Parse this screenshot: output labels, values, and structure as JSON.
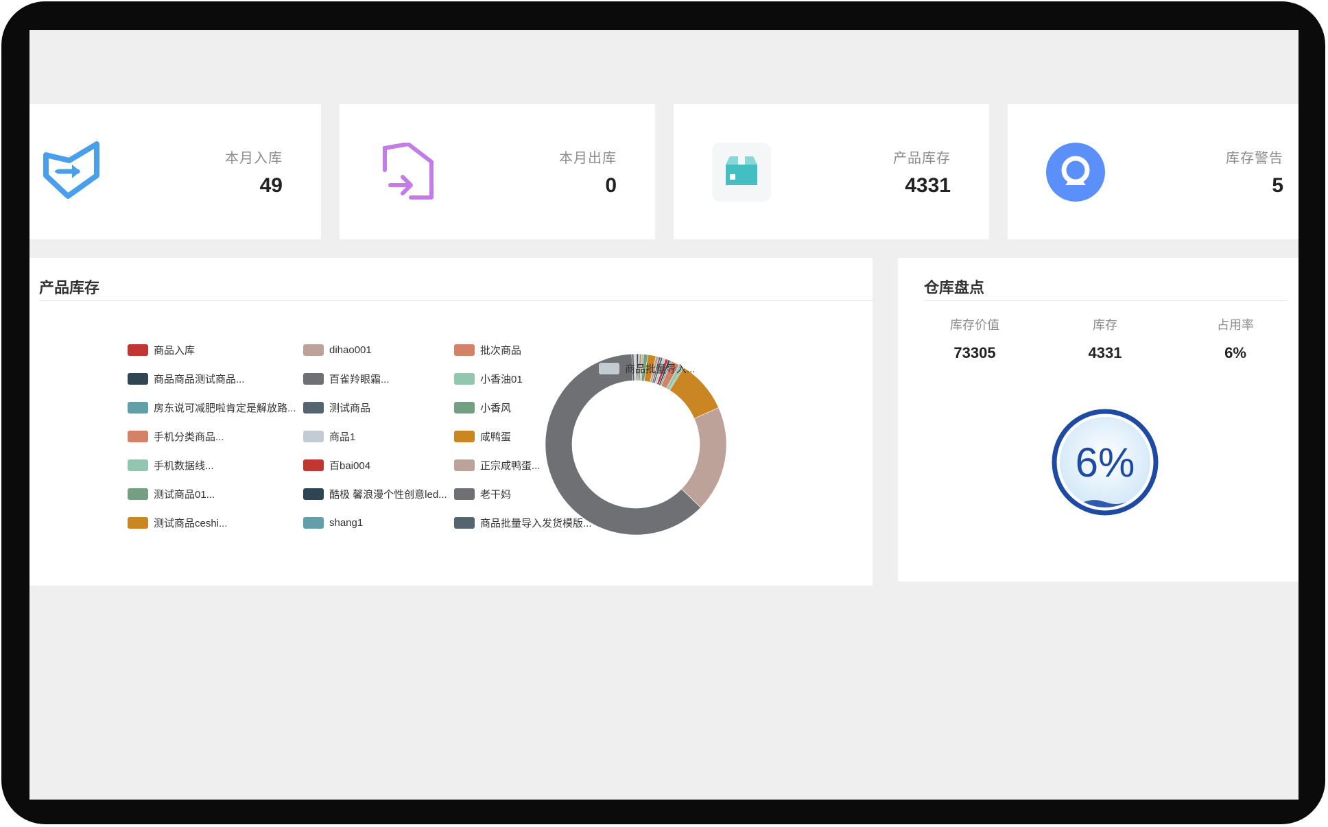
{
  "stats": [
    {
      "label": "本月入库",
      "value": "49",
      "icon": "shield-arrow-in-icon",
      "color": "#4a9fea"
    },
    {
      "label": "本月出库",
      "value": "0",
      "icon": "house-arrow-out-icon",
      "color": "#c27ce8"
    },
    {
      "label": "产品库存",
      "value": "4331",
      "icon": "box-icon",
      "color": "#43bec1"
    },
    {
      "label": "库存警告",
      "value": "5",
      "icon": "webcam-warning-icon",
      "color": "#5b8ff9"
    }
  ],
  "product_stock": {
    "title": "产品库存",
    "legend": [
      {
        "label": "商品入库",
        "color": "#c23531"
      },
      {
        "label": "商品商品测试商品...",
        "color": "#2f4554"
      },
      {
        "label": "房东说可减肥啦肯定是解放路...",
        "color": "#61a0a8"
      },
      {
        "label": "手机分类商品...",
        "color": "#d48265"
      },
      {
        "label": "手机数据线...",
        "color": "#91c7ae"
      },
      {
        "label": "测试商品01...",
        "color": "#749f83"
      },
      {
        "label": "测试商品ceshi...",
        "color": "#ca8622"
      },
      {
        "label": "dihao001",
        "color": "#bda29a"
      },
      {
        "label": "百雀羚眼霜...",
        "color": "#6e7074"
      },
      {
        "label": "测试商品",
        "color": "#546570"
      },
      {
        "label": "商品1",
        "color": "#c4ccd3"
      },
      {
        "label": "百bai004",
        "color": "#c23531"
      },
      {
        "label": "酷极 馨浪漫个性创意led...",
        "color": "#2f4554"
      },
      {
        "label": "shang1",
        "color": "#61a0a8"
      },
      {
        "label": "批次商品",
        "color": "#d48265"
      },
      {
        "label": "小香油01",
        "color": "#91c7ae"
      },
      {
        "label": "小香风",
        "color": "#749f83"
      },
      {
        "label": "咸鸭蛋",
        "color": "#ca8622"
      },
      {
        "label": "正宗咸鸭蛋...",
        "color": "#bda29a"
      },
      {
        "label": "老干妈",
        "color": "#6e7074"
      },
      {
        "label": "商品批量导入发货模版...",
        "color": "#546570"
      },
      {
        "label": "商品批量导入...",
        "color": "#c4ccd3"
      }
    ],
    "chart_data": {
      "type": "pie",
      "slices": [
        {
          "name": "商品入库",
          "value": 4,
          "color": "#c23531"
        },
        {
          "name": "商品商品测试商品...",
          "value": 8,
          "color": "#2f4554"
        },
        {
          "name": "房东说可减肥啦肯定是解放路...",
          "value": 6,
          "color": "#61a0a8"
        },
        {
          "name": "手机分类商品...",
          "value": 10,
          "color": "#d48265"
        },
        {
          "name": "手机数据线...",
          "value": 10,
          "color": "#91c7ae"
        },
        {
          "name": "测试商品01...",
          "value": 20,
          "color": "#749f83"
        },
        {
          "name": "测试商品ceshi...",
          "value": 40,
          "color": "#ca8622"
        },
        {
          "name": "dihao001",
          "value": 14,
          "color": "#bda29a"
        },
        {
          "name": "百雀羚眼霜...",
          "value": 10,
          "color": "#6e7074"
        },
        {
          "name": "测试商品",
          "value": 10,
          "color": "#546570"
        },
        {
          "name": "商品1",
          "value": 14,
          "color": "#c4ccd3"
        },
        {
          "name": "百bai004",
          "value": 14,
          "color": "#c23531"
        },
        {
          "name": "酷极 馨浪漫个性创意led...",
          "value": 10,
          "color": "#2f4554"
        },
        {
          "name": "shang1",
          "value": 8,
          "color": "#61a0a8"
        },
        {
          "name": "批次商品",
          "value": 40,
          "color": "#d48265"
        },
        {
          "name": "小香油01",
          "value": 20,
          "color": "#91c7ae"
        },
        {
          "name": "小香风",
          "value": 6,
          "color": "#749f83"
        },
        {
          "name": "咸鸭蛋",
          "value": 260,
          "color": "#ca8622"
        },
        {
          "name": "正宗咸鸭蛋...",
          "value": 520,
          "color": "#bda29a"
        },
        {
          "name": "老干妈",
          "value": 1700,
          "color": "#6e7074"
        },
        {
          "name": "商品批量导入发货模版...",
          "value": 10,
          "color": "#546570"
        },
        {
          "name": "商品批量导入...",
          "value": 10,
          "color": "#c4ccd3"
        }
      ],
      "tooltip_label": "商品批量导入..."
    }
  },
  "warehouse": {
    "title": "仓库盘点",
    "columns": [
      {
        "label": "库存价值",
        "value": "73305"
      },
      {
        "label": "库存",
        "value": "4331"
      },
      {
        "label": "占用率",
        "value": "6%"
      }
    ],
    "gauge": {
      "text": "6%",
      "percent": 6,
      "color": "#1e4aa3"
    }
  }
}
